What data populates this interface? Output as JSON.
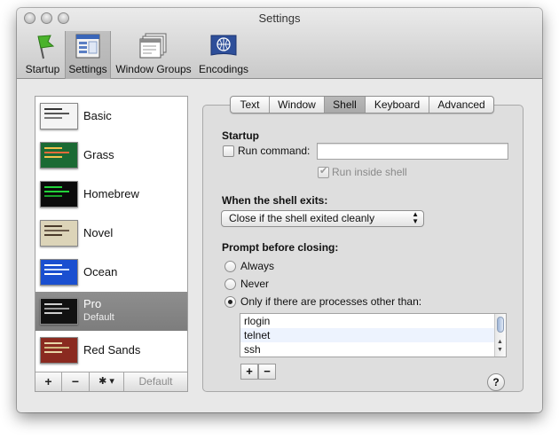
{
  "window": {
    "title": "Settings"
  },
  "toolbar": {
    "items": [
      {
        "label": "Startup",
        "icon": "startup-flag-icon"
      },
      {
        "label": "Settings",
        "icon": "settings-window-icon"
      },
      {
        "label": "Window Groups",
        "icon": "window-groups-icon"
      },
      {
        "label": "Encodings",
        "icon": "encodings-globe-icon"
      }
    ],
    "selected": "Settings"
  },
  "profiles": {
    "items": [
      {
        "name": "Basic",
        "bg": "#f4f4f4",
        "fg": "#333333"
      },
      {
        "name": "Grass",
        "bg": "#1b6a34",
        "fg": "#f2c14e"
      },
      {
        "name": "Homebrew",
        "bg": "#0a0a0a",
        "fg": "#22d33a"
      },
      {
        "name": "Novel",
        "bg": "#dcd4b8",
        "fg": "#4a3a2a"
      },
      {
        "name": "Ocean",
        "bg": "#1a4fd0",
        "fg": "#ffffff"
      },
      {
        "name": "Pro",
        "sub": "Default",
        "bg": "#111111",
        "fg": "#cfcfcf"
      },
      {
        "name": "Red Sands",
        "bg": "#8a2a20",
        "fg": "#e8d6a8"
      }
    ],
    "selected": "Pro",
    "footer": {
      "add": "+",
      "remove": "−",
      "action": "✱ ▾",
      "default_label": "Default"
    }
  },
  "tabs": {
    "items": [
      "Text",
      "Window",
      "Shell",
      "Keyboard",
      "Advanced"
    ],
    "active": "Shell"
  },
  "shell": {
    "startup_heading": "Startup",
    "run_command_label": "Run command:",
    "run_command_value": "",
    "run_inside_shell_label": "Run inside shell",
    "when_exits_heading": "When the shell exits:",
    "when_exits_value": "Close if the shell exited cleanly",
    "prompt_heading": "Prompt before closing:",
    "prompt_options": [
      "Always",
      "Never",
      "Only if there are processes other than:"
    ],
    "prompt_selected": "Only if there are processes other than:",
    "processes": [
      "rlogin",
      "telnet",
      "ssh"
    ],
    "add": "+",
    "remove": "−",
    "help": "?"
  },
  "colors": {
    "selection_gray": "#858585",
    "list_alt_row": "#edf3fe"
  }
}
